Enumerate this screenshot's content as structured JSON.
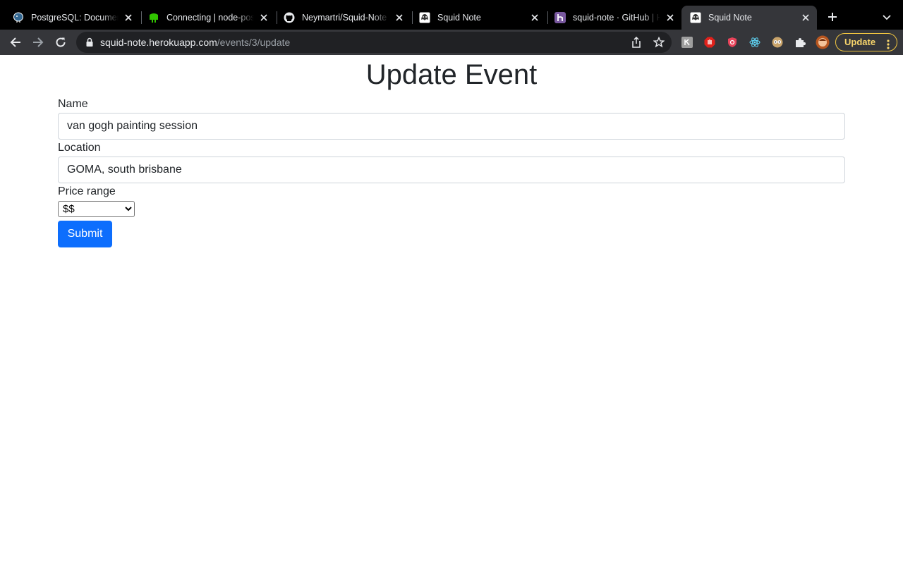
{
  "browser": {
    "tabs": [
      {
        "title": "PostgreSQL: Documentation",
        "icon": "postgresql-elephant-icon",
        "active": false
      },
      {
        "title": "Connecting | node-postgres",
        "icon": "node-postgres-icon",
        "active": false
      },
      {
        "title": "Neymartri/Squid-Note",
        "icon": "github-icon",
        "active": false
      },
      {
        "title": "Squid Note",
        "icon": "squid-note-icon",
        "active": false
      },
      {
        "title": "squid-note · GitHub | Heroku",
        "icon": "heroku-icon",
        "active": false
      },
      {
        "title": "Squid Note",
        "icon": "squid-note-icon",
        "active": true
      }
    ],
    "address": {
      "host": "squid-note.herokuapp.com",
      "path": "/events/3/update"
    },
    "update_label": "Update",
    "colors": {
      "tabstrip": "#000000",
      "toolbar": "#35363a",
      "omnibox": "#202124",
      "update_accent": "#f1c640"
    }
  },
  "page": {
    "title": "Update Event",
    "fields": {
      "name": {
        "label": "Name",
        "value": "van gogh painting session"
      },
      "location": {
        "label": "Location",
        "value": "GOMA, south brisbane"
      },
      "price": {
        "label": "Price range",
        "selected": "$$"
      }
    },
    "submit_label": "Submit",
    "colors": {
      "primary": "#0d6efd",
      "text": "#212529"
    }
  }
}
